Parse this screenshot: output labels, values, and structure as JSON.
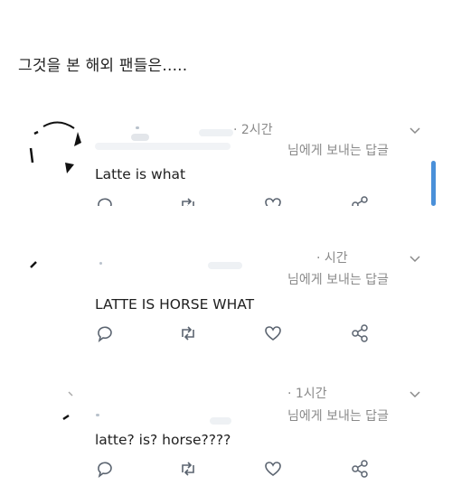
{
  "caption": "그것을 본 해외 팬들은.....",
  "tweets": [
    {
      "time": "· 2시간",
      "reply_to": "님에게 보내는 답글",
      "text": "Latte is what"
    },
    {
      "time": "· 시간",
      "reply_to": "님에게 보내는 답글",
      "text": "LATTE IS HORSE WHAT"
    },
    {
      "time": "· 1시간",
      "reply_to": "님에게 보내는 답글",
      "text": "latte? is? horse????"
    }
  ],
  "icons": {
    "reply": "reply-icon",
    "retweet": "retweet-icon",
    "like": "heart-icon",
    "share": "share-icon",
    "more": "chevron-down-icon"
  },
  "colors": {
    "text": "#1f1f1f",
    "muted": "#8a8a8a",
    "icon": "#5b6470",
    "scrollbar": "#4a90d9"
  }
}
